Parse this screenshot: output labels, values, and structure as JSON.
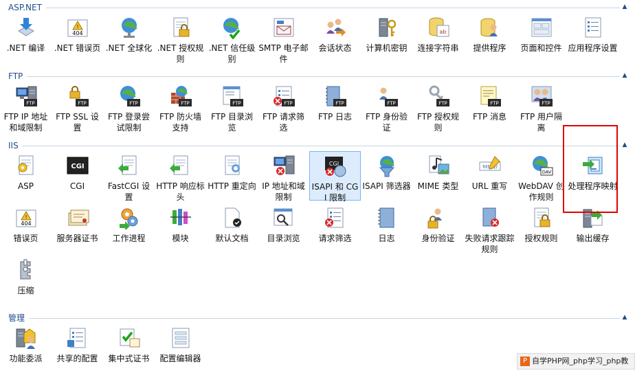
{
  "sections": [
    {
      "title": "ASP.NET",
      "items": [
        {
          "label": ".NET 编译",
          "icon": "download-arrow-icon"
        },
        {
          "label": ".NET 错误页",
          "icon": "error-404-icon"
        },
        {
          "label": ".NET 全球化",
          "icon": "globe-icon"
        },
        {
          "label": ".NET 授权规则",
          "icon": "lock-document-icon"
        },
        {
          "label": ".NET 信任级别",
          "icon": "globe-check-icon"
        },
        {
          "label": "SMTP 电子邮件",
          "icon": "email-icon"
        },
        {
          "label": "会话状态",
          "icon": "users-arrow-icon"
        },
        {
          "label": "计算机密钥",
          "icon": "server-key-icon"
        },
        {
          "label": "连接字符串",
          "icon": "database-text-icon"
        },
        {
          "label": "提供程序",
          "icon": "users-database-icon"
        },
        {
          "label": "页面和控件",
          "icon": "page-controls-icon"
        },
        {
          "label": "应用程序设置",
          "icon": "checklist-icon"
        }
      ]
    },
    {
      "title": "FTP",
      "items": [
        {
          "label": "FTP IP 地址和域限制",
          "icon": "ftp-computer-icon"
        },
        {
          "label": "FTP SSL 设置",
          "icon": "ftp-lock-icon"
        },
        {
          "label": "FTP 登录尝试限制",
          "icon": "ftp-globe-icon"
        },
        {
          "label": "FTP 防火墙支持",
          "icon": "ftp-firewall-icon"
        },
        {
          "label": "FTP 目录浏览",
          "icon": "ftp-directory-icon"
        },
        {
          "label": "FTP 请求筛选",
          "icon": "ftp-filter-icon"
        },
        {
          "label": "FTP 日志",
          "icon": "ftp-log-icon"
        },
        {
          "label": "FTP 身份验证",
          "icon": "ftp-user-icon"
        },
        {
          "label": "FTP 授权规则",
          "icon": "ftp-key-icon"
        },
        {
          "label": "FTP 消息",
          "icon": "ftp-message-icon"
        },
        {
          "label": "FTP 用户隔离",
          "icon": "ftp-users-icon"
        }
      ]
    },
    {
      "title": "IIS",
      "items": [
        {
          "label": "ASP",
          "icon": "asp-document-icon"
        },
        {
          "label": "CGI",
          "icon": "cgi-icon"
        },
        {
          "label": "FastCGI 设置",
          "icon": "fastcgi-icon"
        },
        {
          "label": "HTTP 响应标头",
          "icon": "response-headers-icon"
        },
        {
          "label": "HTTP 重定向",
          "icon": "redirect-icon"
        },
        {
          "label": "IP 地址和域限制",
          "icon": "ip-restriction-icon"
        },
        {
          "label": "ISAPI 和 CGI 限制",
          "icon": "isapi-cgi-icon"
        },
        {
          "label": "ISAPI 筛选器",
          "icon": "isapi-filter-icon"
        },
        {
          "label": "MIME 类型",
          "icon": "mime-icon"
        },
        {
          "label": "URL 重写",
          "icon": "url-rewrite-icon"
        },
        {
          "label": "WebDAV 创作规则",
          "icon": "webdav-icon"
        },
        {
          "label": "处理程序映射",
          "icon": "handler-mappings-icon"
        },
        {
          "label": "错误页",
          "icon": "error-404-icon"
        },
        {
          "label": "服务器证书",
          "icon": "certificates-icon"
        },
        {
          "label": "工作进程",
          "icon": "worker-process-icon"
        },
        {
          "label": "模块",
          "icon": "modules-icon"
        },
        {
          "label": "默认文档",
          "icon": "default-document-icon"
        },
        {
          "label": "目录浏览",
          "icon": "directory-browse-icon"
        },
        {
          "label": "请求筛选",
          "icon": "request-filter-icon"
        },
        {
          "label": "日志",
          "icon": "logging-icon"
        },
        {
          "label": "身份验证",
          "icon": "authentication-icon"
        },
        {
          "label": "失败请求跟踪规则",
          "icon": "failed-request-icon"
        },
        {
          "label": "授权规则",
          "icon": "authorization-icon"
        },
        {
          "label": "输出缓存",
          "icon": "output-cache-icon"
        },
        {
          "label": "压缩",
          "icon": "compression-icon"
        }
      ]
    },
    {
      "title": "管理",
      "items": [
        {
          "label": "功能委派",
          "icon": "feature-delegation-icon"
        },
        {
          "label": "共享的配置",
          "icon": "shared-config-icon"
        },
        {
          "label": "集中式证书",
          "icon": "central-certificates-icon"
        },
        {
          "label": "配置编辑器",
          "icon": "config-editor-icon"
        }
      ]
    }
  ],
  "selected_item": "ISAPI 和 CGI 限制",
  "collapse_glyph": "▲",
  "watermark": {
    "text": "自学PHP网_php学习_php教",
    "icon_text": "P"
  }
}
